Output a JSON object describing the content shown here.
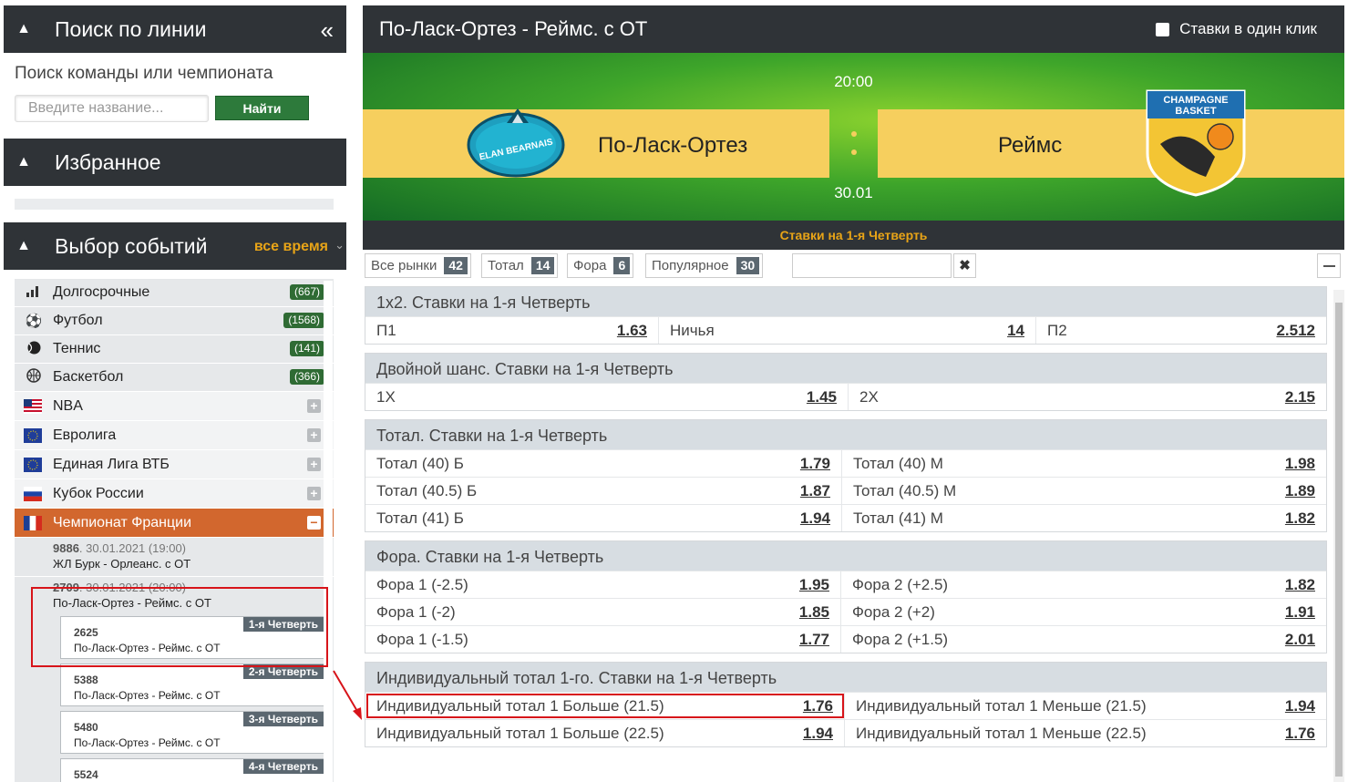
{
  "sidebar": {
    "search_title": "Поиск по линии",
    "search_label": "Поиск команды или чемпионата",
    "search_placeholder": "Введите название...",
    "search_button": "Найти",
    "favorites_title": "Избранное",
    "events_title": "Выбор событий",
    "time_filter": "все время",
    "sports": [
      {
        "icon": "chart-icon",
        "name": "Долгосрочные",
        "count": "(667)"
      },
      {
        "icon": "soccer-ball-icon",
        "name": "Футбол",
        "count": "(1568)"
      },
      {
        "icon": "tennis-ball-icon",
        "name": "Теннис",
        "count": "(141)"
      },
      {
        "icon": "basketball-icon",
        "name": "Баскетбол",
        "count": "(366)"
      }
    ],
    "leagues": [
      {
        "flag": "usa",
        "name": "NBA"
      },
      {
        "flag": "eu",
        "name": "Евролига"
      },
      {
        "flag": "eu",
        "name": "Единая Лига ВТБ"
      },
      {
        "flag": "russia",
        "name": "Кубок России"
      },
      {
        "flag": "france",
        "name": "Чемпионат Франции"
      }
    ],
    "matches": [
      {
        "id": "9886",
        "datetime": ". 30.01.2021 (19:00)",
        "name": "ЖЛ Бурк - Орлеанс. с ОТ"
      },
      {
        "id": "2709",
        "datetime": ". 30.01.2021 (20:00)",
        "name": "По-Ласк-Ортез - Реймс. с ОТ"
      }
    ],
    "sub_events": [
      {
        "id": "2625",
        "name": "По-Ласк-Ортез - Реймс. с ОТ",
        "tag": "1-я Четверть"
      },
      {
        "id": "5388",
        "name": "По-Ласк-Ортез - Реймс. с ОТ",
        "tag": "2-я Четверть"
      },
      {
        "id": "5480",
        "name": "По-Ласк-Ортез - Реймс. с ОТ",
        "tag": "3-я Четверть"
      },
      {
        "id": "5524",
        "name": "",
        "tag": "4-я Четверть"
      }
    ]
  },
  "main": {
    "title": "По-Ласк-Ортез - Реймс. с ОТ",
    "one_click": "Ставки в один клик",
    "team_home": "По-Ласк-Ортез",
    "team_away": "Реймс",
    "time": "20:00",
    "date": "30.01",
    "logo_home_text": "ELAN BEARNAIS",
    "logo_away_text_1": "CHAMPAGNE",
    "logo_away_text_2": "BASKET",
    "period": "Ставки на 1-я Четверть",
    "filters": [
      {
        "label": "Все рынки",
        "count": "42"
      },
      {
        "label": "Тотал",
        "count": "14"
      },
      {
        "label": "Фора",
        "count": "6"
      },
      {
        "label": "Популярное",
        "count": "30"
      }
    ],
    "clear_icon": "✖",
    "markets": [
      {
        "title": "1х2. Ставки на 1-я Четверть",
        "rows": [
          [
            {
              "n": "П1",
              "o": "1.63"
            },
            {
              "n": "Ничья",
              "o": "14"
            },
            {
              "n": "П2",
              "o": "2.512"
            }
          ]
        ]
      },
      {
        "title": "Двойной шанс. Ставки на 1-я Четверть",
        "rows": [
          [
            {
              "n": "1Х",
              "o": "1.45"
            },
            {
              "n": "2Х",
              "o": "2.15"
            }
          ]
        ]
      },
      {
        "title": "Тотал. Ставки на 1-я Четверть",
        "rows": [
          [
            {
              "n": "Тотал (40) Б",
              "o": "1.79"
            },
            {
              "n": "Тотал (40) М",
              "o": "1.98"
            }
          ],
          [
            {
              "n": "Тотал (40.5) Б",
              "o": "1.87"
            },
            {
              "n": "Тотал (40.5) М",
              "o": "1.89"
            }
          ],
          [
            {
              "n": "Тотал (41) Б",
              "o": "1.94"
            },
            {
              "n": "Тотал (41) М",
              "o": "1.82"
            }
          ]
        ]
      },
      {
        "title": "Фора. Ставки на 1-я Четверть",
        "rows": [
          [
            {
              "n": "Фора 1 (-2.5)",
              "o": "1.95"
            },
            {
              "n": "Фора 2 (+2.5)",
              "o": "1.82"
            }
          ],
          [
            {
              "n": "Фора 1 (-2)",
              "o": "1.85"
            },
            {
              "n": "Фора 2 (+2)",
              "o": "1.91"
            }
          ],
          [
            {
              "n": "Фора 1 (-1.5)",
              "o": "1.77"
            },
            {
              "n": "Фора 2 (+1.5)",
              "o": "2.01"
            }
          ]
        ]
      },
      {
        "title": "Индивидуальный тотал 1-го. Ставки на 1-я Четверть",
        "rows": [
          [
            {
              "n": "Индивидуальный тотал 1 Больше (21.5)",
              "o": "1.76"
            },
            {
              "n": "Индивидуальный тотал 1 Меньше (21.5)",
              "o": "1.94"
            }
          ],
          [
            {
              "n": "Индивидуальный тотал 1 Больше (22.5)",
              "o": "1.94"
            },
            {
              "n": "Индивидуальный тотал 1 Меньше (22.5)",
              "o": "1.76"
            }
          ]
        ]
      }
    ]
  },
  "colors": {
    "header": "#2f3337",
    "accent": "#e8a417",
    "active": "#d2672e",
    "button": "#2d7a3b",
    "highlight": "#d7141a"
  }
}
